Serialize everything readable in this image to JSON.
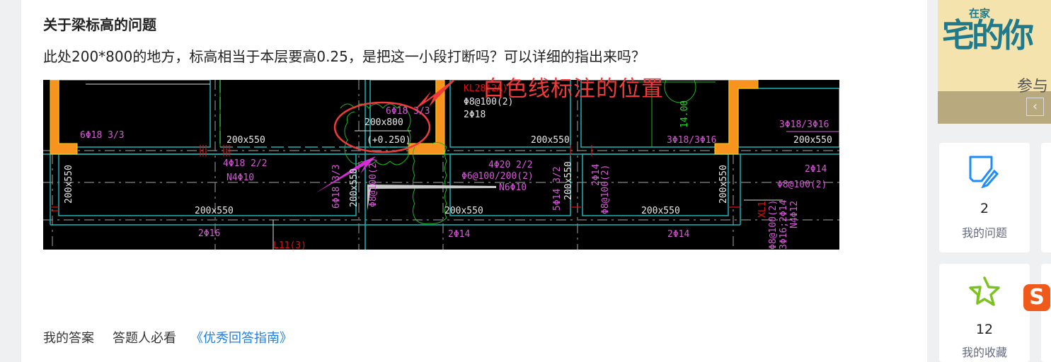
{
  "question": {
    "title": "关于梁标高的问题",
    "body": "此处200*800的地方，标高相当于本层要高0.25，是把这一小段打断吗？可以详细的指出来吗？",
    "annotation": "白色线标注的位置"
  },
  "drawing_labels": {
    "l1": "6Φ18 3/3",
    "l2": "200x550",
    "l3": "4Φ18 2/2",
    "l4": "N4Φ10",
    "l5": "200x550",
    "l6": "200x550",
    "l7": "2Φ16",
    "l8": "L11(3)",
    "l9": "200x800",
    "l10": "(+0.250)",
    "l11": "6Φ18 3/3",
    "l12": "KL28(2A)",
    "l13": "Φ8@100(2)",
    "l14": "2Φ18",
    "l15": "200x550",
    "l16": "4Φ20 2/2",
    "l17": "Φ6@100/200(2)",
    "l18": "N6Φ10",
    "l19": "200x550",
    "l20": "2Φ14",
    "l21": "3Φ18/3Φ16",
    "l22": "14.00",
    "l23": "3Φ18/3Φ16",
    "l24": "200x550",
    "l25": "2Φ14",
    "l26": "Φ8@100(2)",
    "l27": "200x550",
    "l28": "2Φ14",
    "l29": "5Φ14 3/2",
    "l30": "200x550",
    "l31": "2Φ14",
    "l32": "Φ8@100(2)",
    "l33": "200x550",
    "l34": "XL1",
    "l35": "Φ8@100(2)",
    "l36": "3Φ16;2Φ14",
    "l37": "N4Φ12",
    "l38": "6Φ18 3/3",
    "l39": "200x550",
    "l40": "Φ8@100(2)"
  },
  "footer": {
    "my_answer": "我的答案",
    "must_read": "答题人必看",
    "guide_link": "《优秀回答指南》"
  },
  "sidebar": {
    "banner": {
      "logo_big": "宅的你",
      "logo_small": "在家",
      "sub": "参与",
      "prev_icon": "chevron-left-icon"
    },
    "cards": [
      {
        "icon": "edit-note-icon",
        "count": "2",
        "label": "我的问题"
      },
      {
        "icon": "star-icon",
        "count": "12",
        "label": "我的收藏"
      }
    ]
  },
  "colors": {
    "accent": "#1e7fe6",
    "annotation_red": "#f23a3a",
    "cad_cyan": "#19b6b6",
    "cad_magenta": "#d65ad6",
    "column_orange": "#f7931e",
    "star_green": "#7cc31f"
  }
}
